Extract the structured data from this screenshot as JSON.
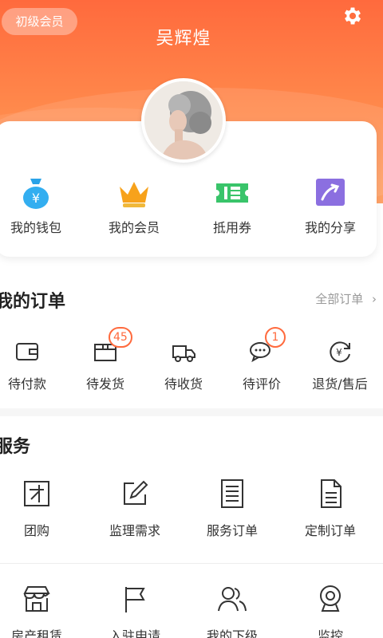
{
  "header": {
    "level_badge": "初级会员",
    "username": "吴辉煌",
    "accent": "#ff6a3d"
  },
  "quick_actions": [
    {
      "label": "我的钱包",
      "icon": "money-bag-icon"
    },
    {
      "label": "我的会员",
      "icon": "crown-icon"
    },
    {
      "label": "抵用券",
      "icon": "ticket-icon"
    },
    {
      "label": "我的分享",
      "icon": "share-icon"
    }
  ],
  "orders": {
    "title": "我的订单",
    "all_link": "全部订单",
    "items": [
      {
        "label": "待付款",
        "icon": "wallet-icon",
        "badge": ""
      },
      {
        "label": "待发货",
        "icon": "box-icon",
        "badge": "45"
      },
      {
        "label": "待收货",
        "icon": "truck-icon",
        "badge": ""
      },
      {
        "label": "待评价",
        "icon": "chat-icon",
        "badge": "1"
      },
      {
        "label": "退货/售后",
        "icon": "refund-icon",
        "badge": ""
      }
    ]
  },
  "services": {
    "title": "服务",
    "row1": [
      {
        "label": "团购",
        "icon": "group-buy-icon"
      },
      {
        "label": "监理需求",
        "icon": "edit-icon"
      },
      {
        "label": "服务订单",
        "icon": "document-icon"
      },
      {
        "label": "定制订单",
        "icon": "file-icon"
      }
    ],
    "row2": [
      {
        "label": "房产租赁",
        "icon": "store-icon"
      },
      {
        "label": "入驻申请",
        "icon": "flag-icon"
      },
      {
        "label": "我的下级",
        "icon": "users-icon"
      },
      {
        "label": "监控",
        "icon": "camera-icon"
      }
    ]
  }
}
